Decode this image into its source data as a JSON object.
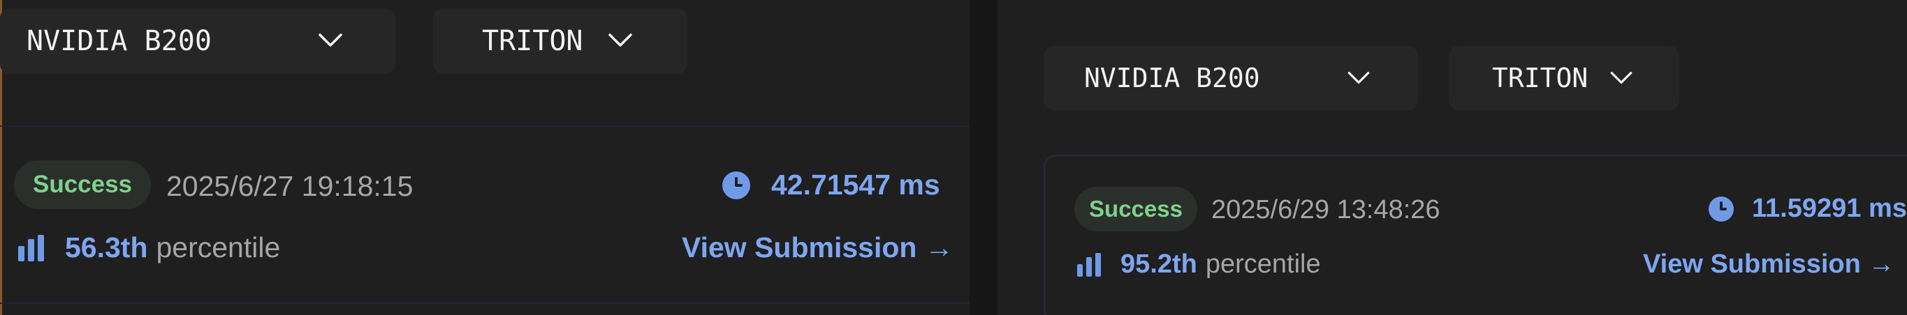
{
  "left": {
    "gpu_select": "NVIDIA B200",
    "lang_select": "TRITON",
    "submission": {
      "status": "Success",
      "timestamp": "2025/6/27 19:18:15",
      "timing": "42.71547 ms",
      "percentile_value": "56.3th",
      "percentile_label": "percentile",
      "link": "View Submission →"
    }
  },
  "right": {
    "gpu_select": "NVIDIA B200",
    "lang_select": "TRITON",
    "submission": {
      "status": "Success",
      "timestamp": "2025/6/29 13:48:26",
      "timing": "11.59291 ms",
      "percentile_value": "95.2th",
      "percentile_label": "percentile",
      "link": "View Submission →"
    }
  },
  "icons": [
    "chevron-down-icon",
    "clock-icon",
    "bar-chart-icon",
    "arrow-right-icon"
  ],
  "colors": {
    "background": "#1f1f20",
    "success": "#7fd18b",
    "accent": "#7ea6f0",
    "muted": "#a6a6a8"
  }
}
